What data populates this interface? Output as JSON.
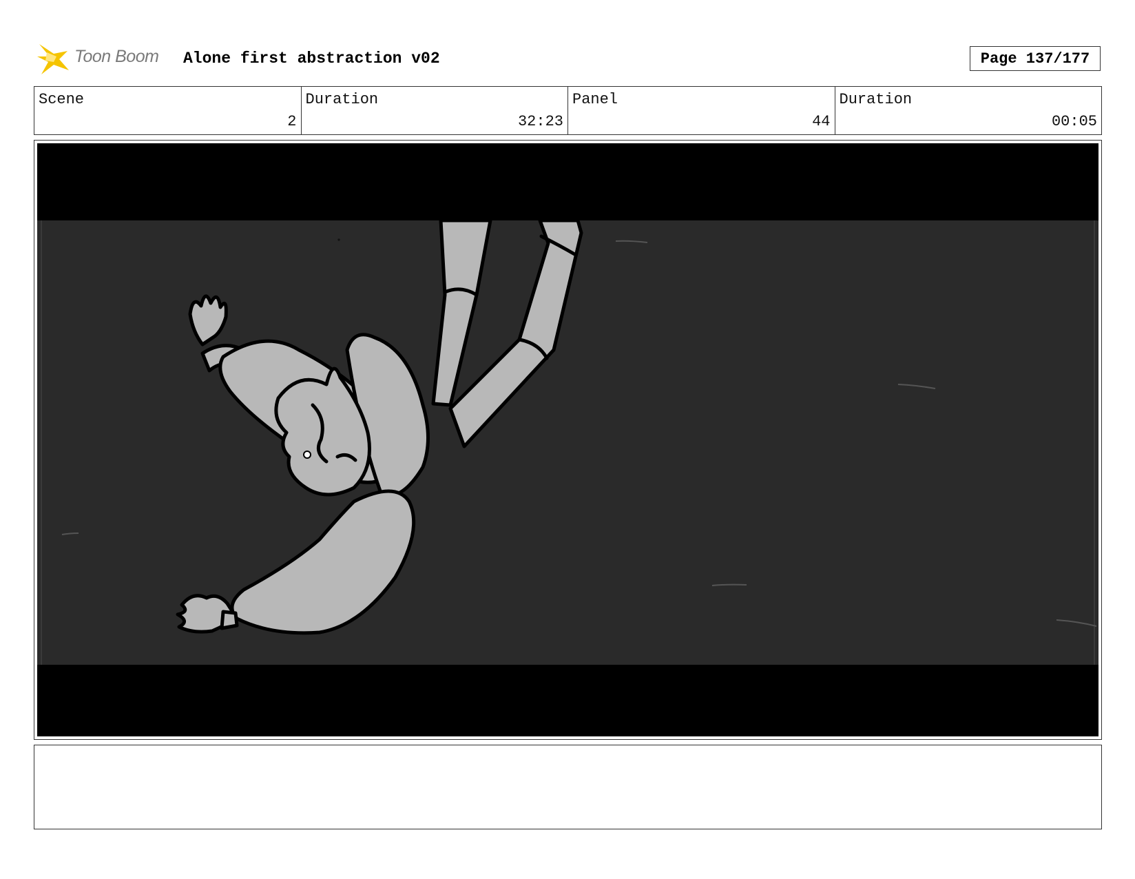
{
  "header": {
    "logo_text": "Toon Boom",
    "title": "Alone first abstraction v02",
    "page_label": "Page 137/177"
  },
  "info": [
    {
      "label": "Scene",
      "value": "2"
    },
    {
      "label": "Duration",
      "value": "32:23"
    },
    {
      "label": "Panel",
      "value": "44"
    },
    {
      "label": "Duration",
      "value": "00:05"
    }
  ],
  "colors": {
    "logo_star": "#f5c400",
    "letterbox": "#000000",
    "background": "#2a2a2a",
    "figure_fill": "#b8b8b8",
    "outline": "#000000"
  },
  "notes": {
    "text": ""
  }
}
